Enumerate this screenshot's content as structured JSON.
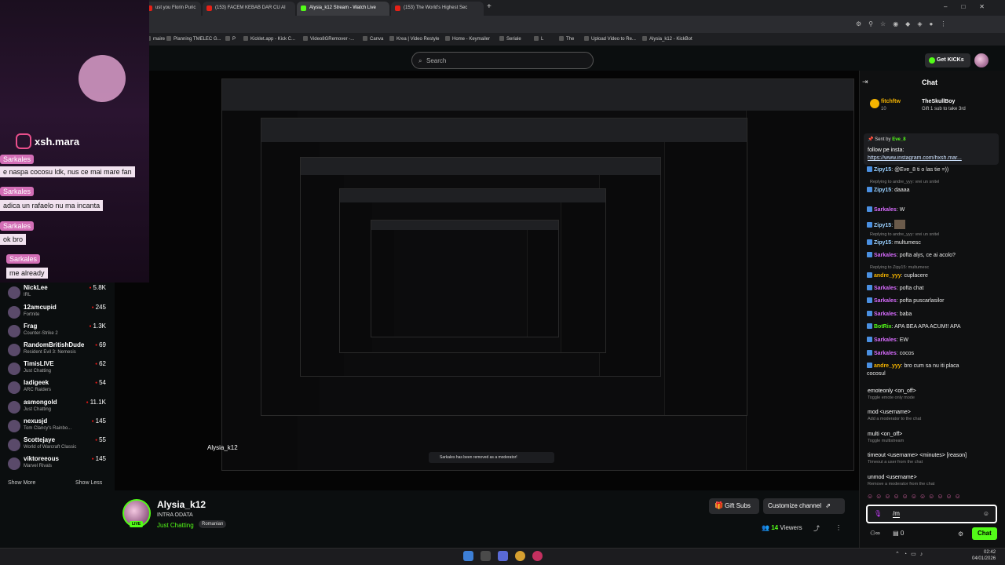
{
  "browser": {
    "tabs": [
      {
        "label": "ust you Florin Puric"
      },
      {
        "label": "(153) FACEM KEBAB DAR CU AI"
      },
      {
        "label": "Alysia_k12 Stream - Watch Live"
      },
      {
        "label": "(153) The World's Highest Sec"
      }
    ],
    "bookmarks": [
      "maire",
      "Planning TMELEC G...",
      "P",
      "Kicklet.app - Kick C...",
      "Video8GRemover -...",
      "Canva",
      "Krea | Video Restyle",
      "Home - Keymailer",
      "Seriale",
      "L",
      "The",
      "Upload Video to Re...",
      "Alysia_k12 - KickBot"
    ]
  },
  "header": {
    "search_placeholder": "Search",
    "get_kicks_label": "Get KICKs"
  },
  "overlay": {
    "instagram_handle": "xsh.mara",
    "messages": [
      {
        "user": "Sarkales",
        "text": "e naspa cocosu ldk, nus ce mai mare fan"
      },
      {
        "user": "Sarkales",
        "text": "adica un rafaelo nu ma incanta"
      },
      {
        "user": "Sarkales",
        "text": "ok bro"
      },
      {
        "user": "Sarkales",
        "text": "me already"
      }
    ]
  },
  "sidebar": {
    "recommended": [
      {
        "name": "NickLee",
        "category": "IRL",
        "viewers": "5.8K"
      },
      {
        "name": "12amcupid",
        "category": "Fortnite",
        "viewers": "245"
      },
      {
        "name": "Frag",
        "category": "Counter-Strike 2",
        "viewers": "1.3K"
      },
      {
        "name": "RandomBritishDude",
        "category": "Resident Evil 3: Nemesis",
        "viewers": "69"
      },
      {
        "name": "TimisLIVE",
        "category": "Just Chatting",
        "viewers": "62"
      },
      {
        "name": "ladigeek",
        "category": "ARC Raiders",
        "viewers": "54"
      },
      {
        "name": "asmongold",
        "category": "Just Chatting",
        "viewers": "11.1K"
      },
      {
        "name": "nexusjd",
        "category": "Tom Clancy's Rainbo...",
        "viewers": "145"
      },
      {
        "name": "Scottejaye",
        "category": "World of Warcraft Classic",
        "viewers": "55"
      },
      {
        "name": "viktoreeous",
        "category": "Marvel Rivals",
        "viewers": "145"
      }
    ],
    "show_more": "Show More",
    "show_less": "Show Less"
  },
  "channel": {
    "name": "Alysia_k12",
    "title": "INTRA ODATA",
    "category": "Just Chatting",
    "tag": "Romanian",
    "live_badge": "LIVE",
    "gift_subs_label": "Gift Subs",
    "customize_label": "Customize channel",
    "viewers_count": "14",
    "viewers_label": "Viewers"
  },
  "chat": {
    "title": "Chat",
    "gift_banner": {
      "top_user": "fitchftw",
      "top_count": "10",
      "gifter": "TheSkullBoy",
      "desc": "Gift 1 sub to take 3rd"
    },
    "pinned": {
      "sent_by_label": "Sent by",
      "sent_by_user": "Eve_8",
      "line1": "follow pe insta:",
      "link": "https://www.instagram.com/hxsh.mar..."
    },
    "messages": [
      {
        "user": "Zipy15",
        "color": "#9ad0ff",
        "text": "@Eve_8 ti o las tie =))",
        "reply": ""
      },
      {
        "user": "Zipy15",
        "color": "#9ad0ff",
        "text": "daaaa",
        "reply": "Replying to andre_yyy: vrei un snitel"
      },
      {
        "user": "Sarkales",
        "color": "#d86cff",
        "text": "W",
        "reply": ""
      },
      {
        "user": "Zipy15",
        "color": "#9ad0ff",
        "text": "",
        "reply": ""
      },
      {
        "user": "Zipy15",
        "color": "#9ad0ff",
        "text": "multumesc",
        "reply": "Replying to andre_yyy: vrei un snitel"
      },
      {
        "user": "Sarkales",
        "color": "#d86cff",
        "text": "pofta alys, ce ai acolo?",
        "reply": ""
      },
      {
        "user": "andre_yyy",
        "color": "#f5b400",
        "text": "cuplacere",
        "reply": "Replying to Zipy15: multumesc"
      },
      {
        "user": "Sarkales",
        "color": "#d86cff",
        "text": "pofta chat",
        "reply": ""
      },
      {
        "user": "Sarkales",
        "color": "#d86cff",
        "text": "pofta puscarlasilor",
        "reply": ""
      },
      {
        "user": "Sarkales",
        "color": "#d86cff",
        "text": "baba",
        "reply": ""
      },
      {
        "user": "BotRix",
        "color": "#53fc18",
        "text": "APA BEA APA ACUM!! APA",
        "reply": ""
      },
      {
        "user": "Sarkales",
        "color": "#d86cff",
        "text": "EW",
        "reply": ""
      },
      {
        "user": "Sarkales",
        "color": "#d86cff",
        "text": "cocos",
        "reply": ""
      },
      {
        "user": "andre_yyy",
        "color": "#f5b400",
        "text": "bro cum sa nu iti placa",
        "reply": ""
      }
    ],
    "last_message_continuation": "cocosul",
    "commands": [
      {
        "cmd": "emoteonly <on_off>",
        "desc": "Toggle emote only mode"
      },
      {
        "cmd": "mod <username>",
        "desc": "Add a moderator to the chat"
      },
      {
        "cmd": "multi <on_off>",
        "desc": "Toggle multistream"
      },
      {
        "cmd": "timeout <username> <minutes> [reason]",
        "desc": "Timeout a user from the chat"
      },
      {
        "cmd": "unmod <username>",
        "desc": "Remove a moderator from the chat"
      }
    ],
    "input_value": "/m",
    "footer_count": "0",
    "send_label": "Chat"
  },
  "video_overlay": {
    "toast": "Sarkales has been removed as a moderator!"
  },
  "taskbar": {
    "time": "02:42",
    "date": "04/01/2026"
  }
}
